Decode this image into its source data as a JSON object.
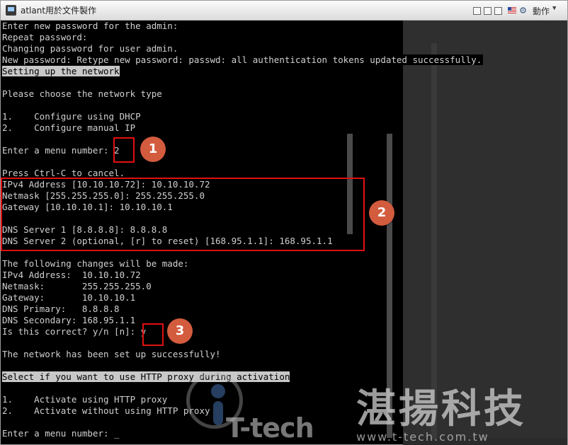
{
  "window": {
    "title": "atlant用於文件製作",
    "actions_label": "動作"
  },
  "colors": {
    "highlight_box": "#e01010",
    "marker_fill": "#d35b3e",
    "terminal_bg": "#000000",
    "terminal_fg": "#d0d0d0"
  },
  "terminal": {
    "lines": [
      "Enter new password for the admin:",
      "Repeat password:",
      "Changing password for user admin.",
      "New password: Retype new password: passwd: all authentication tokens updated successfully.",
      "Setting up the network",
      "",
      "Please choose the network type",
      "",
      "1.    Configure using DHCP",
      "2.    Configure manual IP",
      "",
      "Enter a menu number: 2",
      "",
      "Press Ctrl-C to cancel.",
      "IPv4 Address [10.10.10.72]: 10.10.10.72",
      "Netmask [255.255.255.0]: 255.255.255.0",
      "Gateway [10.10.10.1]: 10.10.10.1",
      "",
      "DNS Server 1 [8.8.8.8]: 8.8.8.8",
      "DNS Server 2 (optional, [r] to reset) [168.95.1.1]: 168.95.1.1",
      "",
      "The following changes will be made:",
      "IPv4 Address:  10.10.10.72",
      "Netmask:       255.255.255.0",
      "Gateway:       10.10.10.1",
      "DNS Primary:   8.8.8.8",
      "DNS Secondary: 168.95.1.1",
      "Is this correct? y/n [n]: y",
      "",
      "The network has been set up successfully!",
      "",
      "Select if you want to use HTTP proxy during activation",
      "",
      "1.    Activate using HTTP proxy",
      "2.    Activate without using HTTP proxy",
      "",
      "Enter a menu number: "
    ],
    "cursor": "_"
  },
  "markers": [
    "1",
    "2",
    "3"
  ],
  "watermark": {
    "brand_cn": "湛揚科技",
    "brand_en": "T-tech",
    "url": "www.t-tech.com.tw"
  }
}
